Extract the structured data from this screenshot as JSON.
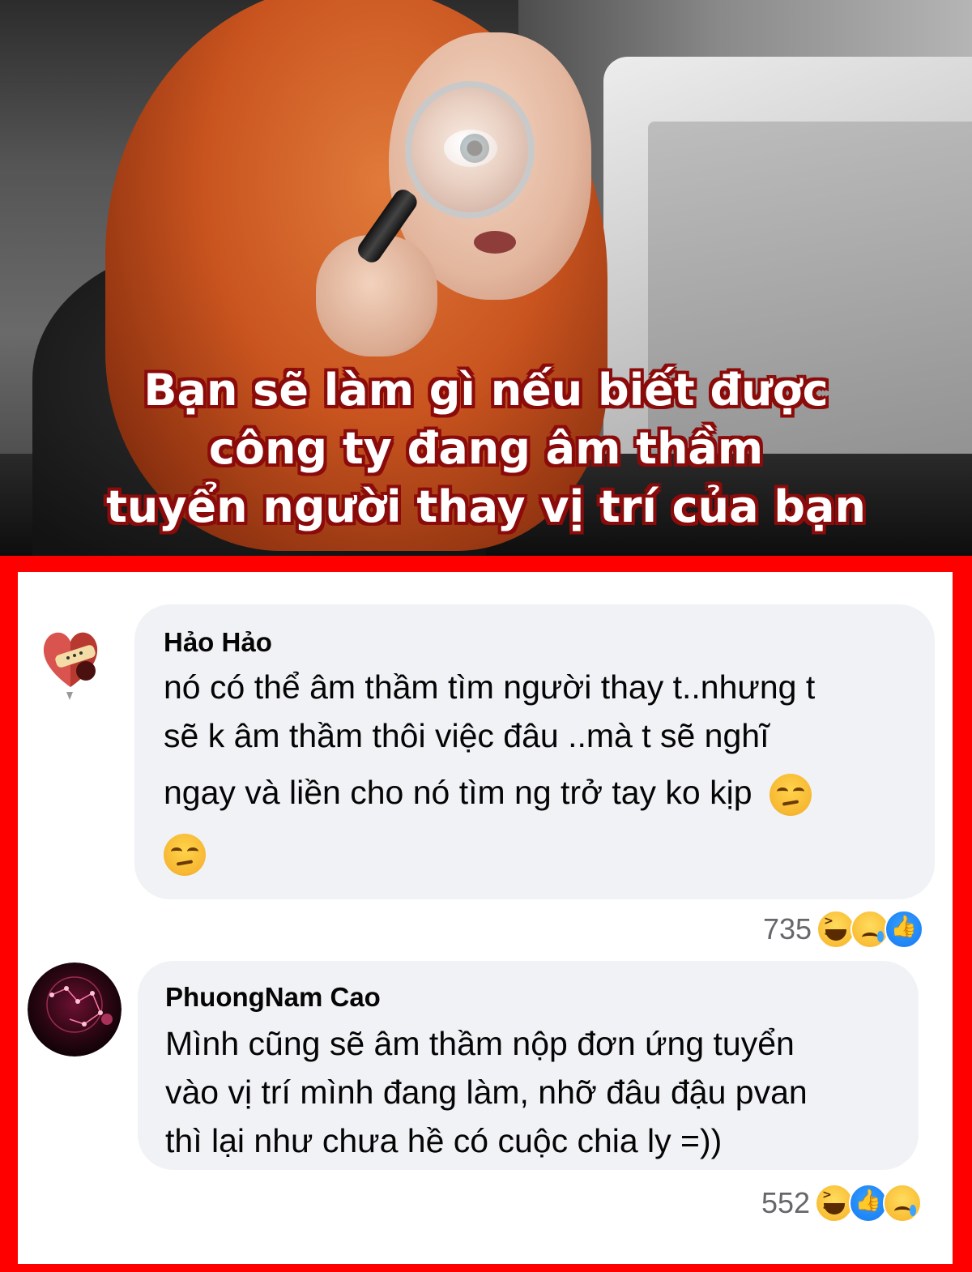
{
  "hero": {
    "caption_lines": [
      "Bạn sẽ làm gì nếu biết được",
      "công ty đang âm thầm",
      "tuyển người thay vị trí của bạn"
    ],
    "caption_color": "#ffffff",
    "caption_outline": "#8b0b0b"
  },
  "frame": {
    "border_color": "#ff0000"
  },
  "comments": [
    {
      "author": "Hảo Hảo",
      "lines": [
        "nó có thể âm thầm tìm người thay t..nhưng t",
        "sẽ k âm thầm thôi việc đâu ..mà t sẽ nghĩ",
        "ngay và liền cho nó tìm ng trở tay ko kịp"
      ],
      "emoji": "unamused-face",
      "reaction_count": "735",
      "reactions": [
        "haha-icon",
        "sad-icon",
        "like-icon"
      ]
    },
    {
      "author": "PhuongNam Cao",
      "lines": [
        "Mình cũng sẽ âm thầm nộp đơn ứng tuyển",
        "vào vị trí mình đang làm, nhỡ đâu đậu pvan",
        "thì lại như chưa hề có cuộc chia ly =))"
      ],
      "reaction_count": "552",
      "reactions": [
        "haha-icon",
        "like-icon",
        "sad-icon"
      ]
    }
  ]
}
